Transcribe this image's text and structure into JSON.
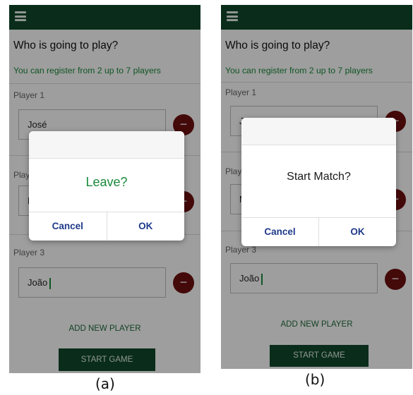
{
  "screens": [
    {
      "title": "Who is going to play?",
      "subtitle": "You can register from 2 up to 7 players",
      "players": [
        {
          "label": "Player 1",
          "name": "José"
        },
        {
          "label": "Player 2",
          "name": "M"
        },
        {
          "label": "Player 3",
          "name": "João"
        }
      ],
      "remove_glyph": "−",
      "add_player_label": "ADD NEW PLAYER",
      "start_game_label": "START GAME",
      "dialog": {
        "message": "Leave?",
        "cancel_label": "Cancel",
        "ok_label": "OK"
      },
      "caption": "(a)"
    },
    {
      "title": "Who is going to play?",
      "subtitle": "You can register from 2 up to 7 players",
      "players": [
        {
          "label": "Player 1",
          "name": "J"
        },
        {
          "label": "Player 2",
          "name": "M"
        },
        {
          "label": "Player 3",
          "name": "João"
        }
      ],
      "remove_glyph": "−",
      "add_player_label": "ADD NEW PLAYER",
      "start_game_label": "START GAME",
      "dialog": {
        "message": "Start Match?",
        "cancel_label": "Cancel",
        "ok_label": "OK"
      },
      "caption": "(b)"
    }
  ],
  "colors": {
    "app_bar": "#0f4a2a",
    "accent_text": "#1a8a3a",
    "remove_button": "#6e1010",
    "dialog_button_text": "#1f3a8a"
  }
}
